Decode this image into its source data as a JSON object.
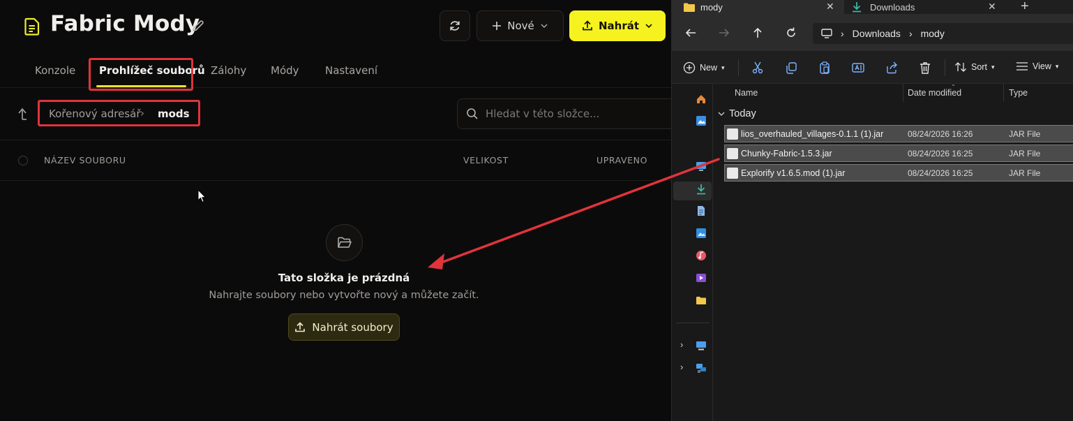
{
  "app": {
    "title": "Fabric Mody",
    "header": {
      "new_label": "Nové",
      "upload_label": "Nahrát"
    },
    "tabs": [
      {
        "label": "Konzole"
      },
      {
        "label": "Prohlížeč souborů"
      },
      {
        "label": "Zálohy"
      },
      {
        "label": "Módy"
      },
      {
        "label": "Nastavení"
      }
    ],
    "breadcrumb": {
      "root": "Kořenový adresář",
      "separator": "›",
      "current": "mods"
    },
    "search": {
      "placeholder": "Hledat v této složce..."
    },
    "table": {
      "col_name": "NÁZEV SOUBORU",
      "col_size": "VELIKOST",
      "col_modified": "UPRAVENO"
    },
    "empty": {
      "title": "Tato složka je prázdná",
      "subtitle": "Nahrajte soubory nebo vytvořte nový a můžete začít.",
      "button_label": "Nahrát soubory"
    },
    "colors": {
      "accent": "#f5f21f",
      "highlight_box": "#e0343c",
      "arrow": "#e0343c"
    }
  },
  "explorer": {
    "tabs": [
      {
        "label": "mody"
      },
      {
        "label": "Downloads"
      }
    ],
    "address": {
      "segments": [
        "Downloads",
        "mody"
      ]
    },
    "commands": {
      "new_label": "New",
      "sort_label": "Sort",
      "view_label": "View"
    },
    "columns": {
      "name": "Name",
      "date": "Date modified",
      "type": "Type"
    },
    "group": {
      "label": "Today"
    },
    "files": [
      {
        "name": "lios_overhauled_villages-0.1.1 (1).jar",
        "date": "08/24/2026 16:26",
        "type": "JAR File"
      },
      {
        "name": "Chunky-Fabric-1.5.3.jar",
        "date": "08/24/2026 16:25",
        "type": "JAR File"
      },
      {
        "name": "Explorify v1.6.5.mod (1).jar",
        "date": "08/24/2026 16:25",
        "type": "JAR File"
      }
    ]
  }
}
